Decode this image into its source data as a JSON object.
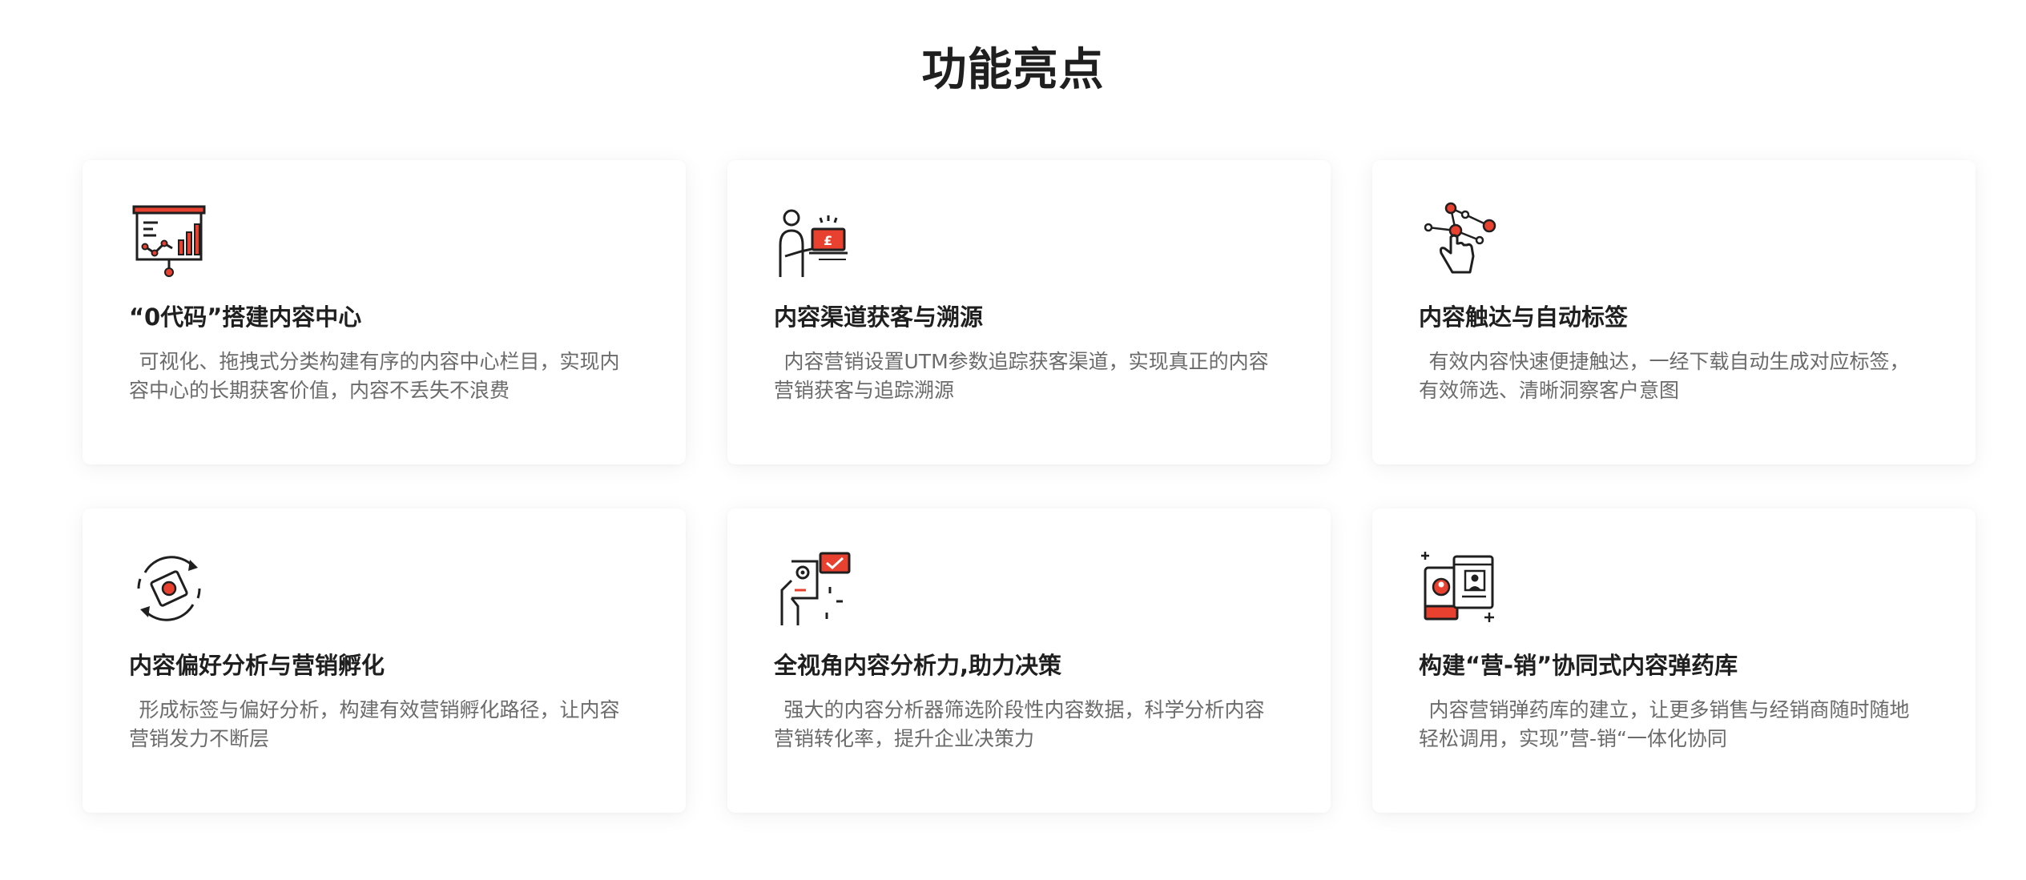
{
  "section": {
    "title": "功能亮点"
  },
  "colors": {
    "accent": "#e8412f",
    "ink": "#1f1f1f",
    "muted": "#6b6b6b"
  },
  "cards": [
    {
      "icon": "presentation-chart-icon",
      "title": "“0代码”搭建内容中心",
      "desc": "可视化、拖拽式分类构建有序的内容中心栏目，实现内容中心的长期获客价值，内容不丢失不浪费"
    },
    {
      "icon": "person-laptop-icon",
      "title": "内容渠道获客与溯源",
      "desc": "内容营销设置UTM参数追踪获客渠道，实现真正的内容营销获客与追踪溯源"
    },
    {
      "icon": "hand-network-icon",
      "title": "内容触达与自动标签",
      "desc": "有效内容快速便捷触达，一经下载自动生成对应标签，有效筛选、清晰洞察客户意图"
    },
    {
      "icon": "cycle-target-icon",
      "title": "内容偏好分析与营销孵化",
      "desc": "形成标签与偏好分析，构建有效营销孵化路径，让内容营销发力不断层"
    },
    {
      "icon": "hand-settings-check-icon",
      "title": "全视角内容分析力,助力决策",
      "desc": "强大的内容分析器筛选阶段性内容数据，科学分析内容营销转化率，提升企业决策力"
    },
    {
      "icon": "devices-profile-icon",
      "title": "构建“营-销”协同式内容弹药库",
      "desc": "内容营销弹药库的建立，让更多销售与经销商随时随地轻松调用，实现”营-销“一体化协同"
    }
  ]
}
